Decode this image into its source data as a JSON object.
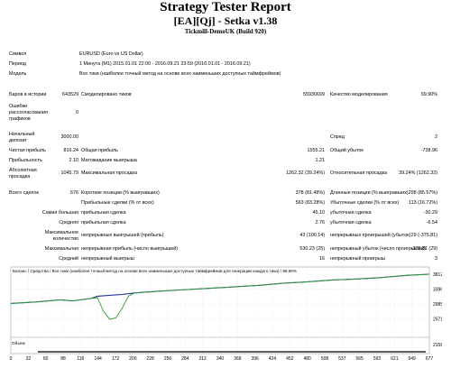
{
  "report": {
    "title": "Strategy Tester Report",
    "subtitle": "[EA][Qj] - Setka v1.38",
    "server": "Tickmill-DemoUK (Build 920)"
  },
  "info": [
    {
      "label": "Символ",
      "value": "EURUSD (Euro vs US Dollar)"
    },
    {
      "label": "Период",
      "value": "1 Минута (M1) 2015.01.01 22:00 - 2016.09.21 23:59 (2016.01.01 - 2016.09.21)"
    },
    {
      "label": "Модель",
      "value": "Все тики (наиболее точный метод на основе всех наименьших доступных таймфреймов)"
    }
  ],
  "stats": {
    "bars_label": "Баров в истории",
    "bars": "643529",
    "ticks_label": "Смоделировано тиков",
    "ticks": "55930699",
    "quality_label": "Качество моделирования",
    "quality": "99.90%",
    "errors_label_1": "Ошибки",
    "errors_label_2": "рассогласования",
    "errors_label_3": "графиков",
    "errors": "0",
    "deposit_label_1": "Начальный",
    "deposit_label_2": "депозит",
    "deposit": "3000.00",
    "spread_label": "Спред",
    "spread": "2",
    "net_profit_label": "Чистая прибыль",
    "net_profit": "816.24",
    "gross_profit_label": "Общая прибыль",
    "gross_profit": "1555.21",
    "gross_loss_label": "Общий убыток",
    "gross_loss": "-738.96",
    "pf_label": "Прибыльность",
    "pf": "2.10",
    "expected_label": "Матожидание выигрыша",
    "expected": "1.21",
    "abs_dd_label_1": "Абсолютная",
    "abs_dd_label_2": "просадка",
    "abs_dd": "1045.79",
    "max_dd_label": "Максимальная просадка",
    "max_dd": "1262.32 (39.24%)",
    "rel_dd_label": "Относительная просадка",
    "rel_dd": "39.24% (1262.32)",
    "total_trades_label": "Всего сделок",
    "total_trades": "676",
    "short_label": "Короткие позиции (% выигравших)",
    "short": "378 (81.48%)",
    "long_label": "Длинные позиции (% выигравших)",
    "long": "298 (85.57%)",
    "profit_trades_label": "Прибыльные сделки (% от всех)",
    "profit_trades": "563 (83.28%)",
    "loss_trades_label": "Убыточные сделки (% от всех)",
    "loss_trades": "113 (16.72%)",
    "largest_label": "Самая большая",
    "avg_label": "Средняя",
    "largest_profit_label": "прибыльная сделка",
    "largest_profit": "45.10",
    "largest_loss_label": "убыточная сделка",
    "largest_loss": "-30.29",
    "avg_profit_label": "прибыльная сделка",
    "avg_profit": "2.76",
    "avg_loss_label": "убыточная сделка",
    "avg_loss": "-6.54",
    "max_label_1": "Максимальное",
    "max_label_2": "количество",
    "max_cons_wins_label": "непрерывных выигрышей (прибыль)",
    "max_cons_wins": "43 (100.14)",
    "max_cons_losses_label": "непрерывных проигрышей (убыток)",
    "max_cons_losses": "29 (-375.81)",
    "maximal_label": "Максимальная",
    "max_cons_profit_label": "непрерывная прибыль (число выигрышей)",
    "max_cons_profit": "530.23 (25)",
    "max_cons_loss_label": "непрерывный убыток (число проигрышей)",
    "max_cons_loss": "-375.81 (29)",
    "average_label": "Средний",
    "avg_cons_wins_label": "непрерывный выигрыш",
    "avg_cons_wins": "16",
    "avg_cons_losses_label": "непрерывный проигрыш",
    "avg_cons_losses": "3"
  },
  "chart_data": {
    "type": "line",
    "legend": "Баланс / Средства / Все тики (наиболее точный метод на основе всех наименьших доступных таймфреймов для генерации каждого тика) / 99.90%",
    "legend_position": "top-left",
    "volume_label": "Объем",
    "x_ticks": [
      "0",
      "32",
      "60",
      "88",
      "116",
      "144",
      "172",
      "200",
      "228",
      "256",
      "284",
      "312",
      "340",
      "368",
      "396",
      "424",
      "452",
      "480",
      "508",
      "537",
      "565",
      "593",
      "621",
      "649",
      "677"
    ],
    "y_ticks": [
      "3812",
      "3396",
      "2985",
      "2571",
      "2158"
    ],
    "y_ticks_volume": [
      "2158"
    ],
    "ylim": [
      2158,
      3812
    ],
    "grid": true,
    "colors": {
      "balance": "#1f3a93",
      "equity": "#2e9e2e",
      "volume": "#000000"
    },
    "series": [
      {
        "name": "Баланс",
        "x": [
          0,
          40,
          80,
          100,
          130,
          140,
          180,
          200,
          240,
          280,
          320,
          360,
          400,
          440,
          480,
          520,
          560,
          600,
          640,
          677
        ],
        "y": [
          3000,
          3040,
          3100,
          3070,
          3140,
          3200,
          3250,
          3290,
          3340,
          3380,
          3420,
          3460,
          3500,
          3560,
          3600,
          3650,
          3680,
          3720,
          3780,
          3812
        ]
      },
      {
        "name": "Средства",
        "x": [
          0,
          40,
          80,
          100,
          130,
          140,
          150,
          160,
          170,
          180,
          190,
          200,
          240,
          280,
          320,
          360,
          400,
          440,
          480,
          520,
          560,
          600,
          640,
          677
        ],
        "y": [
          3000,
          3040,
          3100,
          3070,
          3140,
          3160,
          2780,
          2560,
          2600,
          2860,
          3200,
          3290,
          3340,
          3380,
          3420,
          3460,
          3500,
          3560,
          3600,
          3650,
          3680,
          3720,
          3780,
          3812
        ]
      }
    ]
  }
}
